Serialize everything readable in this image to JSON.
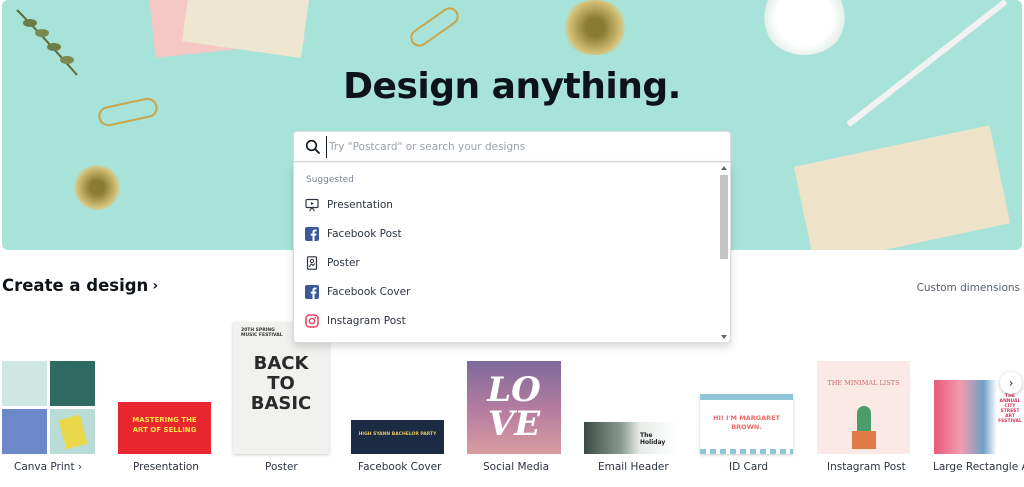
{
  "hero": {
    "title": "Design anything.",
    "background_color": "#a8e3d9"
  },
  "search": {
    "placeholder": "Try \"Postcard\" or search your designs",
    "icon": "search-icon"
  },
  "dropdown": {
    "heading": "Suggested",
    "items": [
      {
        "label": "Presentation",
        "icon": "presentation-icon"
      },
      {
        "label": "Facebook Post",
        "icon": "facebook-icon"
      },
      {
        "label": "Poster",
        "icon": "poster-icon"
      },
      {
        "label": "Facebook Cover",
        "icon": "facebook-icon"
      },
      {
        "label": "Instagram Post",
        "icon": "instagram-icon"
      }
    ]
  },
  "section": {
    "title": "Create a design",
    "custom_dimensions": "Custom dimensions"
  },
  "cards": [
    {
      "label": "Canva Print"
    },
    {
      "label": "Presentation",
      "thumb_text_1": "MASTERING THE",
      "thumb_text_2": "ART OF SELLING"
    },
    {
      "label": "Poster",
      "thumb_text_1": "BACK",
      "thumb_text_2": "TO",
      "thumb_text_3": "BASIC",
      "thumb_text_4": "20TH SPRING MUSIC FESTIVAL"
    },
    {
      "label": "Facebook Cover",
      "thumb_text_1": "HIGH SYANN BACHELOR PARTY"
    },
    {
      "label": "Social Media",
      "thumb_text_1": "LO",
      "thumb_text_2": "VE"
    },
    {
      "label": "Email Header",
      "thumb_text_1": "The Holiday"
    },
    {
      "label": "ID Card",
      "thumb_text_1": "HI! I'M MARGARET",
      "thumb_text_2": "BROWN."
    },
    {
      "label": "Instagram Post",
      "thumb_text_1": "THE MINIMAL LISTS"
    },
    {
      "label": "Large Rectangle Ad",
      "thumb_text_1": "THE ANNUAL CITY STREET ART FESTIVAL"
    }
  ]
}
